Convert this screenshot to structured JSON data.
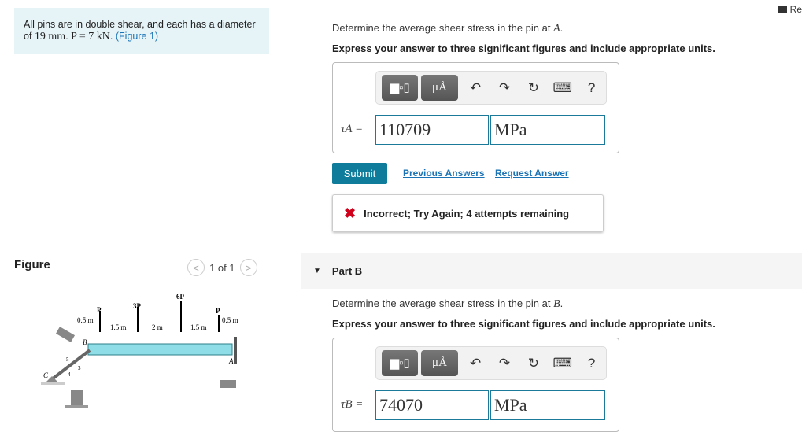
{
  "problem": {
    "text1": "All pins are in double shear, and each has a diameter of ",
    "d": "19 mm",
    "text2": ". ",
    "p": "P = 7 kN",
    "text3": ". ",
    "figure_link": "(Figure 1)"
  },
  "figure": {
    "title": "Figure",
    "pager": "1 of 1",
    "labels": {
      "P1": "P",
      "P2": "3P",
      "P3": "6P",
      "P4": "P",
      "d1": "0.5 m",
      "d2": "1.5 m",
      "d3": "2 m",
      "d4": "1.5 m",
      "d5": "0.5 m",
      "A": "A",
      "B": "B",
      "C": "C",
      "s5": "5",
      "s3": "3",
      "s4": "4"
    }
  },
  "review": "Re",
  "partA": {
    "question": "Determine the average shear stress in the pin at ",
    "point": "A",
    "question_end": ".",
    "instructions": "Express your answer to three significant figures and include appropriate units.",
    "label": "τA =",
    "value": "110709",
    "units": "MPa",
    "submit": "Submit",
    "previous": "Previous Answers",
    "request": "Request Answer",
    "feedback": "Incorrect; Try Again; 4 attempts remaining"
  },
  "toolbar": {
    "units_btn": "μÅ",
    "help": "?"
  },
  "partB": {
    "title": "Part B",
    "question": "Determine the average shear stress in the pin at ",
    "point": "B",
    "question_end": ".",
    "instructions": "Express your answer to three significant figures and include appropriate units.",
    "label": "τB =",
    "value": "74070",
    "units": "MPa"
  }
}
